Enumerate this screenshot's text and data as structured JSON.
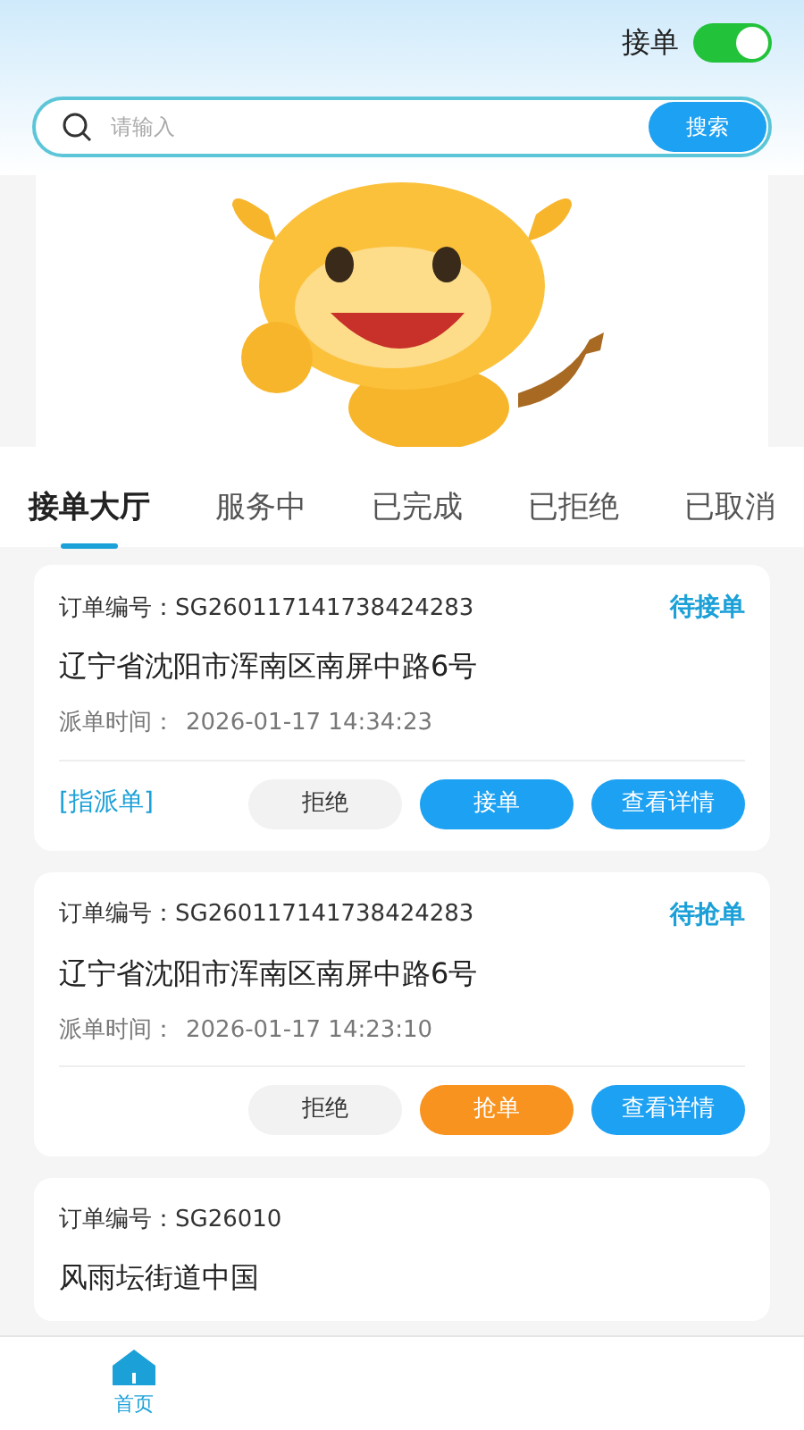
{
  "header": {
    "toggle_label": "接单",
    "toggle_on": true
  },
  "search": {
    "placeholder": "请输入",
    "button": "搜索"
  },
  "tabs": [
    {
      "label": "接单大厅",
      "selected": true
    },
    {
      "label": "服务中",
      "selected": false
    },
    {
      "label": "已完成",
      "selected": false
    },
    {
      "label": "已拒绝",
      "selected": false
    },
    {
      "label": "已取消",
      "selected": false
    }
  ],
  "orders": [
    {
      "order_no": "订单编号：SG260117141738424283",
      "status": "待接单",
      "address": "辽宁省沈阳市浑南区南屏中路6号",
      "time_label": "派单时间：",
      "time": "2026-01-17 14:34:23",
      "tag": "[指派单]",
      "buttons": [
        {
          "kind": "reject",
          "label": "拒绝"
        },
        {
          "kind": "accept",
          "label": "接单"
        },
        {
          "kind": "details",
          "label": "查看详情"
        }
      ]
    },
    {
      "order_no": "订单编号：SG260117141738424283",
      "status": "待抢单",
      "address": "辽宁省沈阳市浑南区南屏中路6号",
      "time_label": "派单时间：",
      "time": "2026-01-17 14:23:10",
      "buttons": [
        {
          "kind": "reject",
          "label": "拒绝"
        },
        {
          "kind": "grab",
          "label": "抢单"
        },
        {
          "kind": "details",
          "label": "查看详情"
        }
      ]
    },
    {
      "order_no": "订单编号：SG26010",
      "address": "风雨坛街道中国"
    }
  ],
  "bottom_nav": [
    {
      "label": "首页",
      "selected": true
    }
  ]
}
